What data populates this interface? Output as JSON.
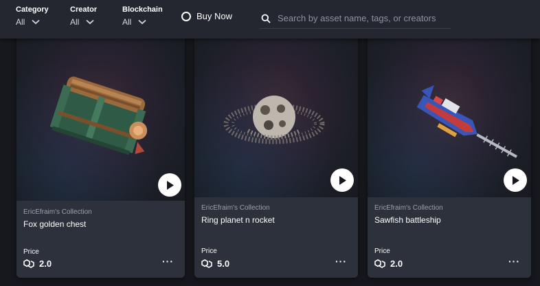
{
  "filters": {
    "category": {
      "label": "Category",
      "value": "All"
    },
    "creator": {
      "label": "Creator",
      "value": "All"
    },
    "blockchain": {
      "label": "Blockchain",
      "value": "All"
    }
  },
  "buy_now": {
    "label": "Buy Now",
    "checked": false
  },
  "search": {
    "placeholder": "Search by asset name, tags, or creators",
    "value": ""
  },
  "price_label": "Price",
  "cards": [
    {
      "collection": "EricEfraim's Collection",
      "title": "Fox golden chest",
      "price": "2.0",
      "image": "fox-golden-chest"
    },
    {
      "collection": "EricEfraim's Collection",
      "title": "Ring planet n rocket",
      "price": "5.0",
      "image": "ring-planet-rocket"
    },
    {
      "collection": "EricEfraim's Collection",
      "title": "Sawfish battleship",
      "price": "2.0",
      "image": "sawfish-battleship"
    }
  ],
  "colors": {
    "background": "#16181d",
    "filterbar": "#24272f",
    "card": "#2d313b",
    "muted_text": "#9ca1ad"
  }
}
